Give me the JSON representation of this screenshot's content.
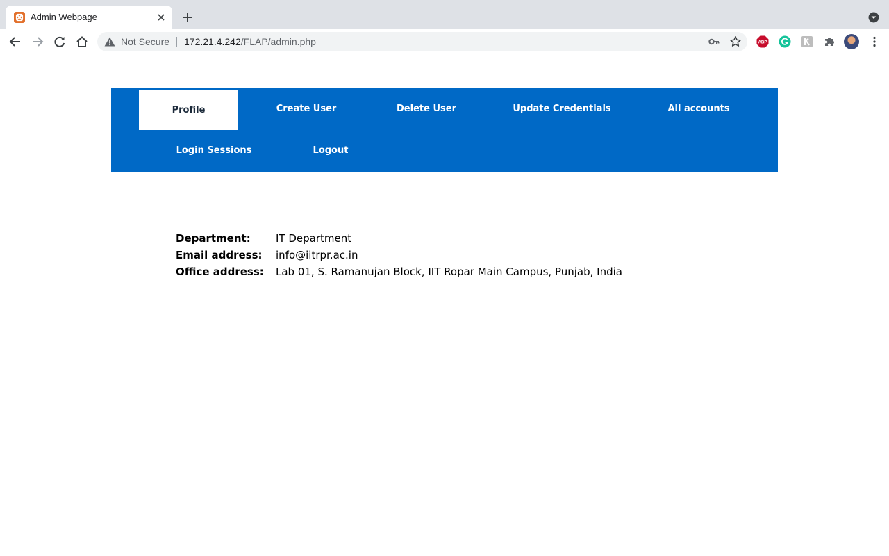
{
  "browser": {
    "tab_title": "Admin Webpage",
    "security_label": "Not Secure",
    "url_host": "172.21.4.242",
    "url_path": "/FLAP/admin.php",
    "extensions": [
      "adblock-plus-icon",
      "grammarly-icon",
      "keyboard-extension-icon",
      "puzzle-extensions-icon"
    ]
  },
  "nav": {
    "items": [
      {
        "label": "Profile",
        "active": true
      },
      {
        "label": "Create User"
      },
      {
        "label": "Delete User"
      },
      {
        "label": "Update Credentials"
      },
      {
        "label": "All accounts"
      },
      {
        "label": "Login Sessions"
      },
      {
        "label": "Logout"
      }
    ]
  },
  "profile": {
    "department_label": "Department:",
    "department_value": "IT Department",
    "email_label": "Email address:",
    "email_value": "info@iitrpr.ac.in",
    "office_label": "Office address:",
    "office_value": "Lab 01, S. Ramanujan Block, IIT Ropar Main Campus, Punjab, India"
  },
  "colors": {
    "nav_bg": "#0069c6",
    "active_tab_bg": "#ffffff",
    "favicon": "#e2702c"
  }
}
